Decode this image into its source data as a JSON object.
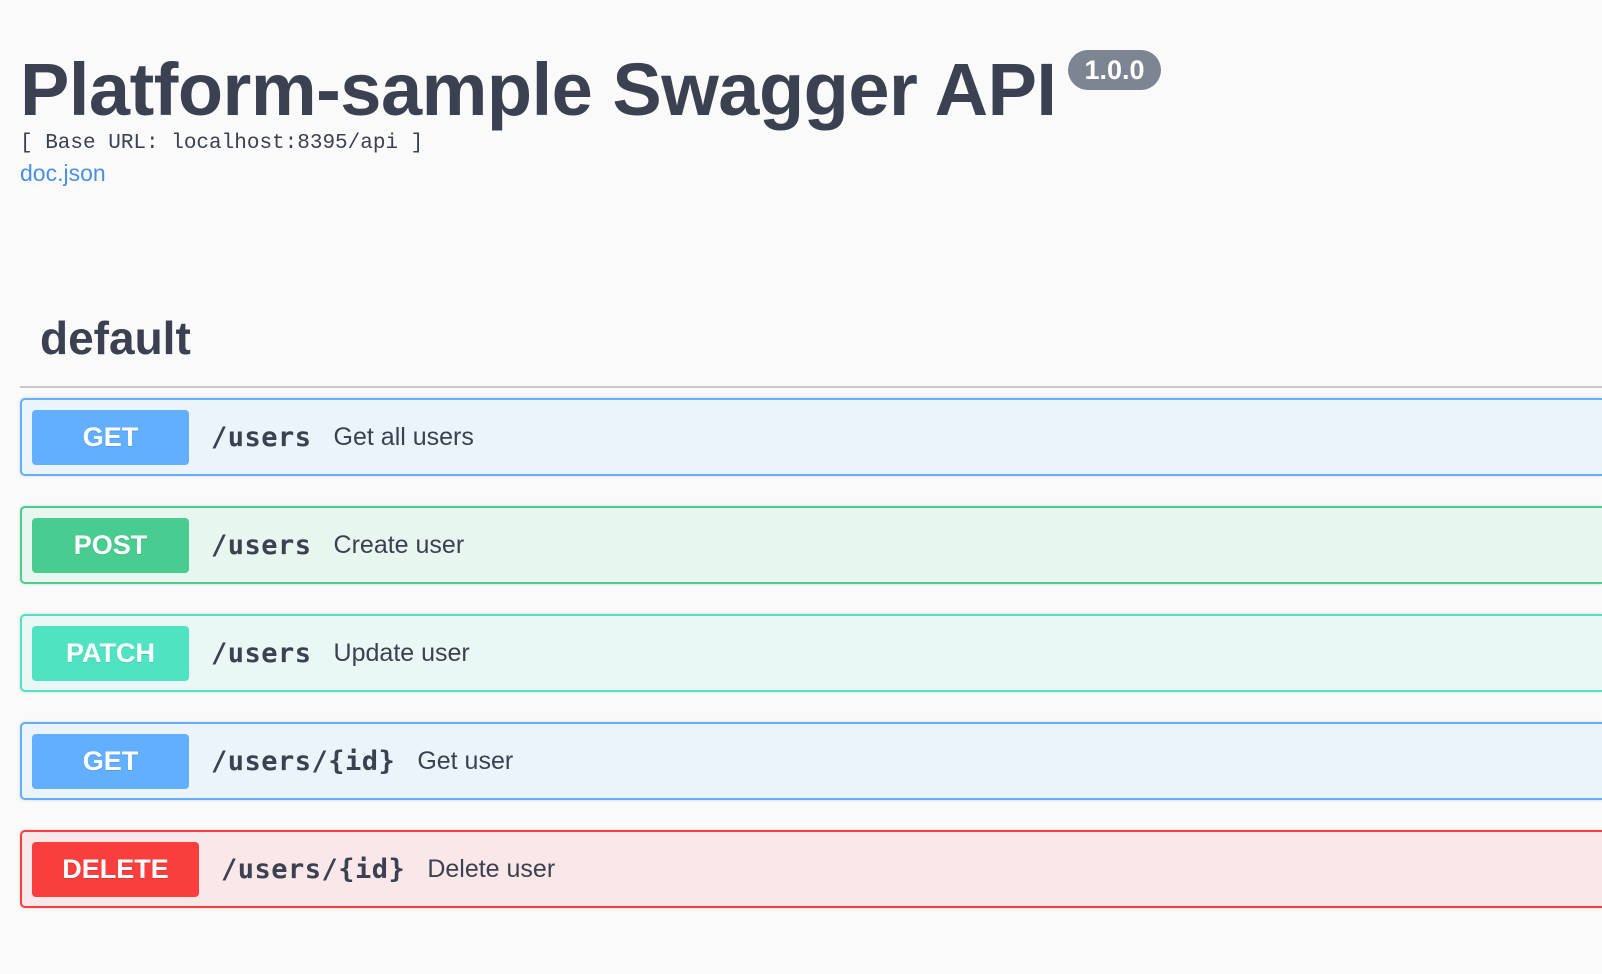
{
  "info": {
    "title": "Platform-sample Swagger API",
    "version": "1.0.0",
    "base_url": "[ Base URL: localhost:8395/api ]",
    "doc_link": "doc.json"
  },
  "tag": {
    "name": "default"
  },
  "operations": [
    {
      "method": "GET",
      "path": "/users",
      "summary": "Get all users",
      "color": "#61affe"
    },
    {
      "method": "POST",
      "path": "/users",
      "summary": "Create user",
      "color": "#49cc90"
    },
    {
      "method": "PATCH",
      "path": "/users",
      "summary": "Update user",
      "color": "#50e3c2"
    },
    {
      "method": "GET",
      "path": "/users/{id}",
      "summary": "Get user",
      "color": "#61affe"
    },
    {
      "method": "DELETE",
      "path": "/users/{id}",
      "summary": "Delete user",
      "color": "#f93e3e"
    }
  ]
}
